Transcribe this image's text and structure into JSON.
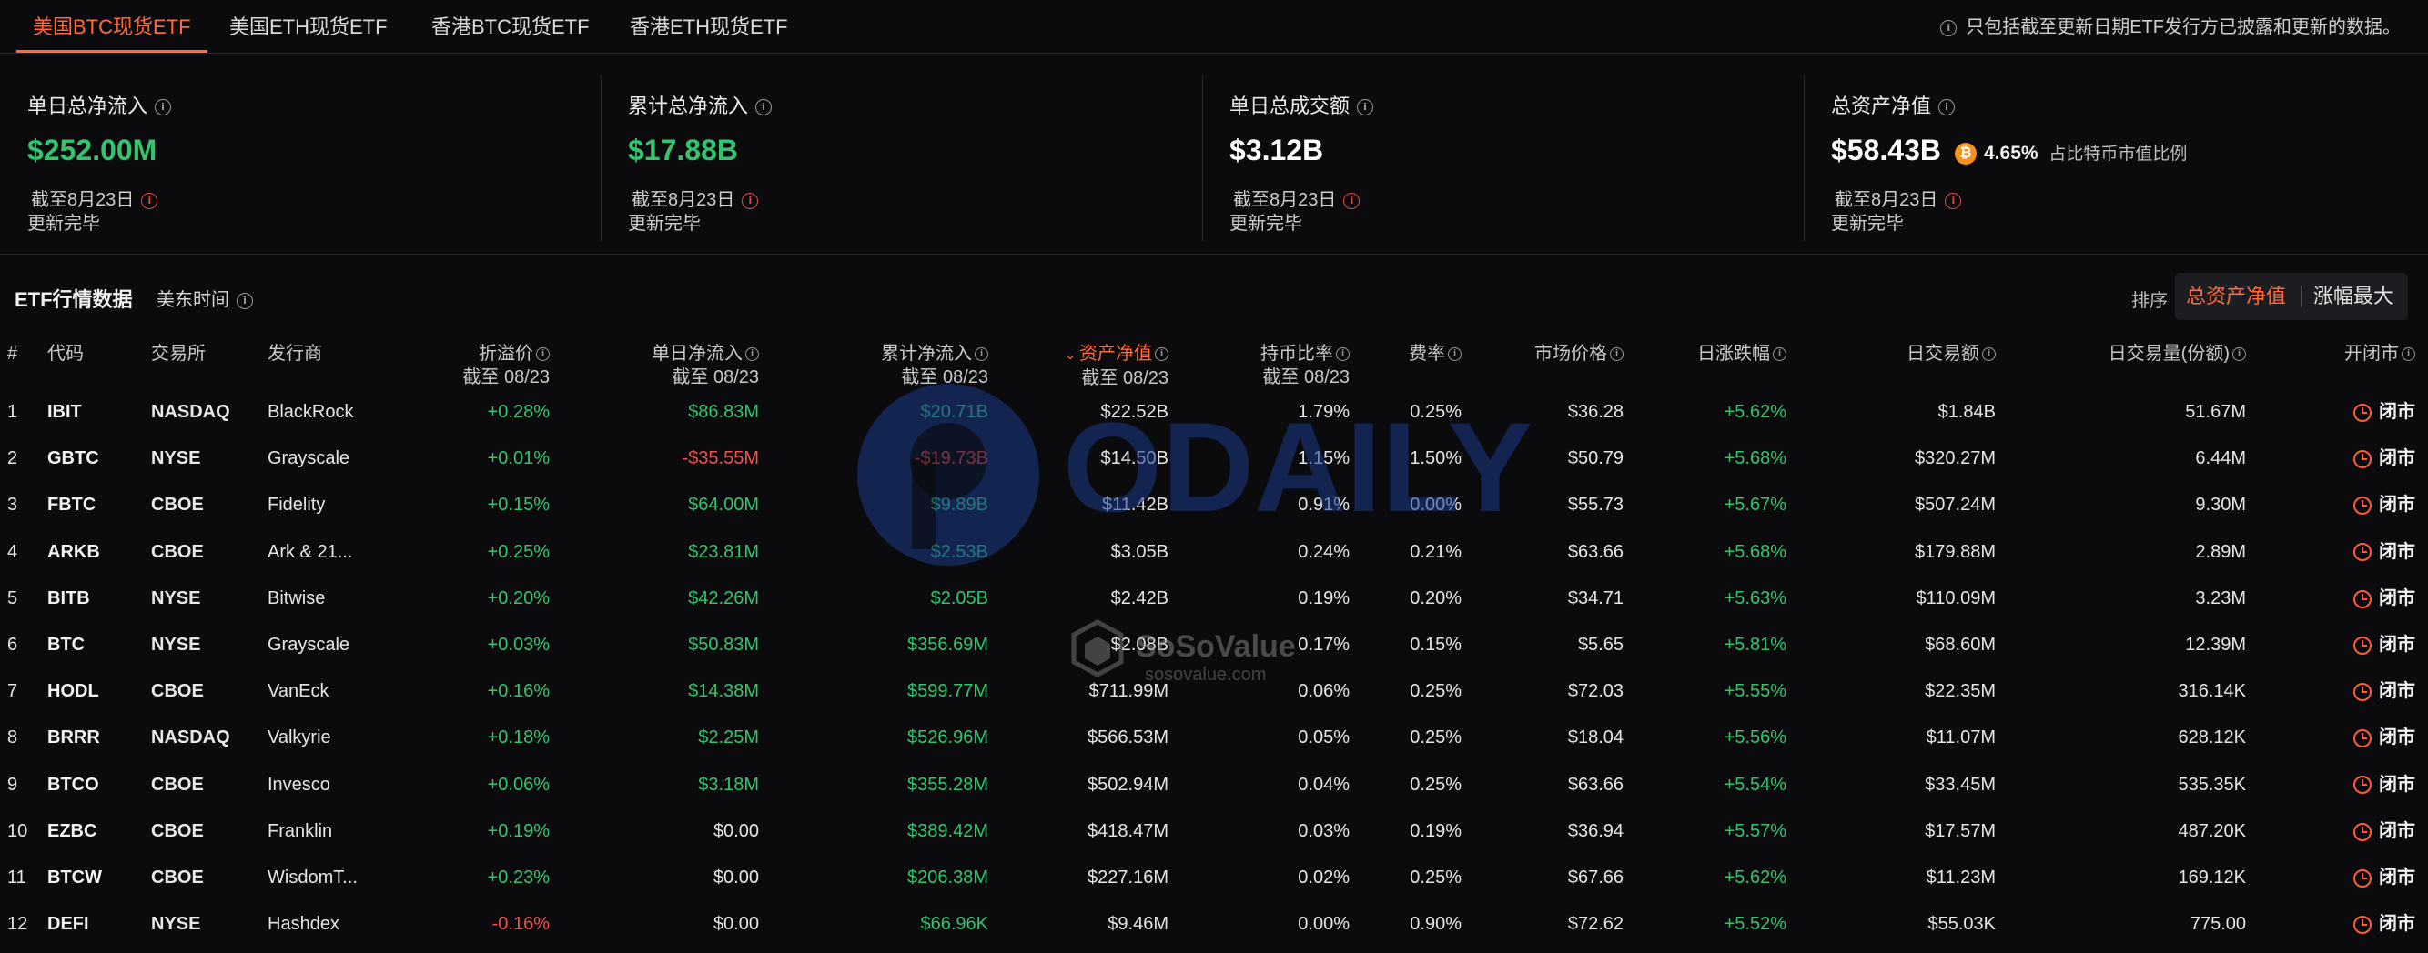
{
  "tabs": [
    "美国BTC现货ETF",
    "美国ETH现货ETF",
    "香港BTC现货ETF",
    "香港ETH现货ETF"
  ],
  "note": "只包括截至更新日期ETF发行方已披露和更新的数据。",
  "cards": [
    {
      "label": "单日总净流入",
      "value": "$252.00M",
      "date": "截至8月23日",
      "status": "更新完毕"
    },
    {
      "label": "累计总净流入",
      "value": "$17.88B",
      "date": "截至8月23日",
      "status": "更新完毕"
    },
    {
      "label": "单日总成交额",
      "value": "$3.12B",
      "date": "截至8月23日",
      "status": "更新完毕"
    },
    {
      "label": "总资产净值",
      "value": "$58.43B",
      "btc_pct": "4.65%",
      "btc_pct_label": "占比特币市值比例",
      "date": "截至8月23日",
      "status": "更新完毕"
    }
  ],
  "section": {
    "title": "ETF行情数据",
    "timezone": "美东时间",
    "sort_label": "排序",
    "sort_active": "总资产净值",
    "sort_other": "涨幅最大"
  },
  "columns": {
    "num": "#",
    "code": "代码",
    "exchange": "交易所",
    "issuer": "发行商",
    "premium": "折溢价",
    "daily_flow": "单日净流入",
    "cum_flow": "累计净流入",
    "aum": "资产净值",
    "holding": "持币比率",
    "fee": "费率",
    "price": "市场价格",
    "change": "日涨跌幅",
    "turnover": "日交易额",
    "volume": "日交易量(份额)",
    "market": "开闭市",
    "asof": "截至 08/23"
  },
  "rows": [
    {
      "n": "1",
      "code": "IBIT",
      "exch": "NASDAQ",
      "issuer": "BlackRock",
      "prem": "+0.28%",
      "flow": "$86.83M",
      "cum": "$20.71B",
      "aum": "$22.52B",
      "hold": "1.79%",
      "fee": "0.25%",
      "price": "$36.28",
      "chg": "+5.62%",
      "turn": "$1.84B",
      "vol": "51.67M",
      "mkt": "闭市"
    },
    {
      "n": "2",
      "code": "GBTC",
      "exch": "NYSE",
      "issuer": "Grayscale",
      "prem": "+0.01%",
      "flow": "-$35.55M",
      "cum": "-$19.73B",
      "aum": "$14.50B",
      "hold": "1.15%",
      "fee": "1.50%",
      "price": "$50.79",
      "chg": "+5.68%",
      "turn": "$320.27M",
      "vol": "6.44M",
      "mkt": "闭市"
    },
    {
      "n": "3",
      "code": "FBTC",
      "exch": "CBOE",
      "issuer": "Fidelity",
      "prem": "+0.15%",
      "flow": "$64.00M",
      "cum": "$9.89B",
      "aum": "$11.42B",
      "hold": "0.91%",
      "fee": "0.00%",
      "price": "$55.73",
      "chg": "+5.67%",
      "turn": "$507.24M",
      "vol": "9.30M",
      "mkt": "闭市"
    },
    {
      "n": "4",
      "code": "ARKB",
      "exch": "CBOE",
      "issuer": "Ark & 21...",
      "prem": "+0.25%",
      "flow": "$23.81M",
      "cum": "$2.53B",
      "aum": "$3.05B",
      "hold": "0.24%",
      "fee": "0.21%",
      "price": "$63.66",
      "chg": "+5.68%",
      "turn": "$179.88M",
      "vol": "2.89M",
      "mkt": "闭市"
    },
    {
      "n": "5",
      "code": "BITB",
      "exch": "NYSE",
      "issuer": "Bitwise",
      "prem": "+0.20%",
      "flow": "$42.26M",
      "cum": "$2.05B",
      "aum": "$2.42B",
      "hold": "0.19%",
      "fee": "0.20%",
      "price": "$34.71",
      "chg": "+5.63%",
      "turn": "$110.09M",
      "vol": "3.23M",
      "mkt": "闭市"
    },
    {
      "n": "6",
      "code": "BTC",
      "exch": "NYSE",
      "issuer": "Grayscale",
      "prem": "+0.03%",
      "flow": "$50.83M",
      "cum": "$356.69M",
      "aum": "$2.08B",
      "hold": "0.17%",
      "fee": "0.15%",
      "price": "$5.65",
      "chg": "+5.81%",
      "turn": "$68.60M",
      "vol": "12.39M",
      "mkt": "闭市"
    },
    {
      "n": "7",
      "code": "HODL",
      "exch": "CBOE",
      "issuer": "VanEck",
      "prem": "+0.16%",
      "flow": "$14.38M",
      "cum": "$599.77M",
      "aum": "$711.99M",
      "hold": "0.06%",
      "fee": "0.25%",
      "price": "$72.03",
      "chg": "+5.55%",
      "turn": "$22.35M",
      "vol": "316.14K",
      "mkt": "闭市"
    },
    {
      "n": "8",
      "code": "BRRR",
      "exch": "NASDAQ",
      "issuer": "Valkyrie",
      "prem": "+0.18%",
      "flow": "$2.25M",
      "cum": "$526.96M",
      "aum": "$566.53M",
      "hold": "0.05%",
      "fee": "0.25%",
      "price": "$18.04",
      "chg": "+5.56%",
      "turn": "$11.07M",
      "vol": "628.12K",
      "mkt": "闭市"
    },
    {
      "n": "9",
      "code": "BTCO",
      "exch": "CBOE",
      "issuer": "Invesco",
      "prem": "+0.06%",
      "flow": "$3.18M",
      "cum": "$355.28M",
      "aum": "$502.94M",
      "hold": "0.04%",
      "fee": "0.25%",
      "price": "$63.66",
      "chg": "+5.54%",
      "turn": "$33.45M",
      "vol": "535.35K",
      "mkt": "闭市"
    },
    {
      "n": "10",
      "code": "EZBC",
      "exch": "CBOE",
      "issuer": "Franklin",
      "prem": "+0.19%",
      "flow": "$0.00",
      "cum": "$389.42M",
      "aum": "$418.47M",
      "hold": "0.03%",
      "fee": "0.19%",
      "price": "$36.94",
      "chg": "+5.57%",
      "turn": "$17.57M",
      "vol": "487.20K",
      "mkt": "闭市"
    },
    {
      "n": "11",
      "code": "BTCW",
      "exch": "CBOE",
      "issuer": "WisdomT...",
      "prem": "+0.23%",
      "flow": "$0.00",
      "cum": "$206.38M",
      "aum": "$227.16M",
      "hold": "0.02%",
      "fee": "0.25%",
      "price": "$67.66",
      "chg": "+5.62%",
      "turn": "$11.23M",
      "vol": "169.12K",
      "mkt": "闭市"
    },
    {
      "n": "12",
      "code": "DEFI",
      "exch": "NYSE",
      "issuer": "Hashdex",
      "prem": "-0.16%",
      "flow": "$0.00",
      "cum": "$66.96K",
      "aum": "$9.46M",
      "hold": "0.00%",
      "fee": "0.90%",
      "price": "$72.62",
      "chg": "+5.52%",
      "turn": "$55.03K",
      "vol": "775.00",
      "mkt": "闭市"
    }
  ],
  "watermarks": {
    "odaily": "ODAILY",
    "soso": "SoSoValue",
    "soso_url": "sosovalue.com"
  },
  "colors": {
    "accent": "#ff6a3d",
    "positive": "#33c56e",
    "negative": "#f0514a",
    "bg": "#0b0b0d",
    "btc": "#f7931a"
  }
}
